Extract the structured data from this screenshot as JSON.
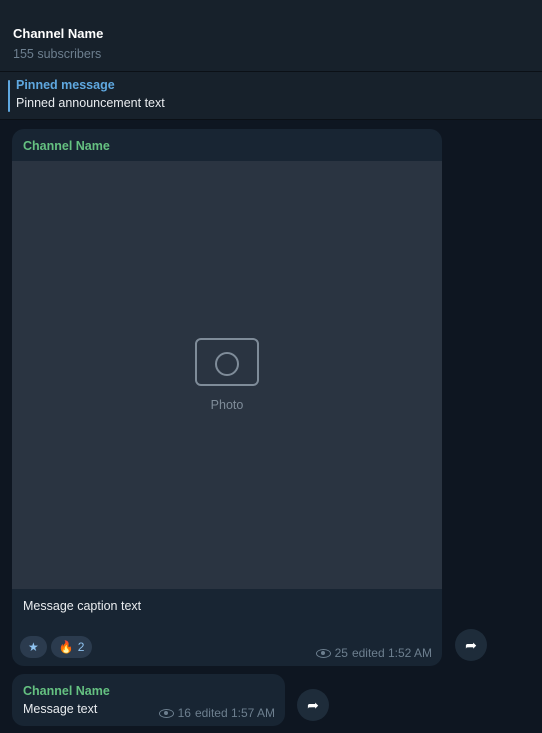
{
  "channel": {
    "title": "Channel Name",
    "subtitle": "155 subscribers"
  },
  "pinned": {
    "label": "Pinned message",
    "text": "Pinned announcement text"
  },
  "messages": [
    {
      "sender": "Channel Name",
      "media_label": "Photo",
      "caption": "Message caption text",
      "reactions": [
        {
          "icon": "star-icon",
          "glyph": "★",
          "count": ""
        },
        {
          "icon": "fire-icon",
          "glyph": "🔥",
          "count": "2"
        }
      ],
      "views": "25",
      "time": "edited 1:52 AM"
    },
    {
      "sender": "Channel Name",
      "text": "Message text",
      "views": "16",
      "time": "edited 1:57 AM"
    }
  ],
  "colors": {
    "background": "#0e1621",
    "panel": "#17212b",
    "bubble": "#182533",
    "sender": "#65c181",
    "accent": "#5fa8e0"
  }
}
